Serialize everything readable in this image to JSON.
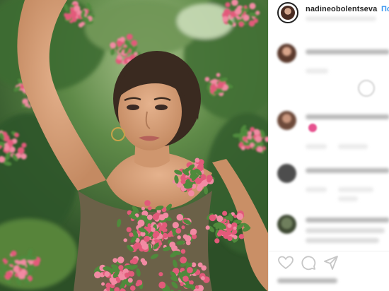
{
  "post": {
    "username": "nadineobolentseva",
    "follow_label": "Подп"
  },
  "photo": {
    "subject": "woman among pink hawthorn blossoms",
    "colors": {
      "foliage": "#3f6d34",
      "blossom": "#e25a7a",
      "dress": "#6b6148",
      "skin": "#d9a27c",
      "hair": "#3a2a20"
    }
  },
  "comments": [
    {
      "author": "nadineobolentseva",
      "blurred": true
    },
    {
      "author": "sofia.beatrice.sasha",
      "blurred": true,
      "has_emoji": true
    },
    {
      "author": "unknown.user",
      "blurred": true
    },
    {
      "author": "unknown.user",
      "blurred": true
    }
  ],
  "actions": {
    "like_icon": "heart-icon",
    "comment_icon": "comment-icon",
    "share_icon": "share-icon",
    "save_icon": "bookmark-icon"
  },
  "theme": {
    "accent": "#3897f0",
    "text": "#262626",
    "border": "#efefef"
  }
}
